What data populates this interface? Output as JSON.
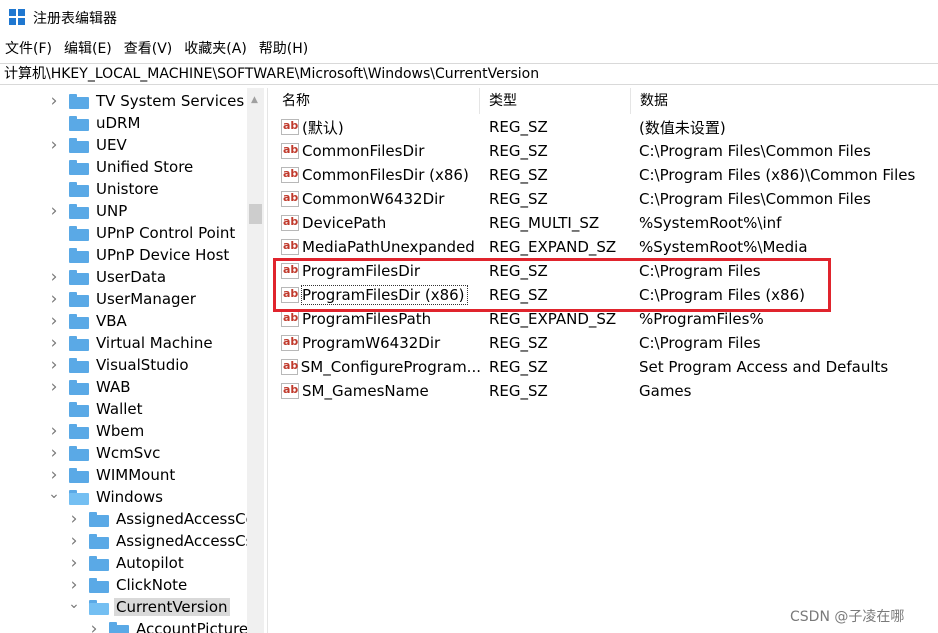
{
  "window": {
    "title": "注册表编辑器",
    "brand_color": "#1f77d0",
    "highlight_color": "#e0242d"
  },
  "menu": [
    "文件(F)",
    "编辑(E)",
    "查看(V)",
    "收藏夹(A)",
    "帮助(H)"
  ],
  "address": "计算机\\HKEY_LOCAL_MACHINE\\SOFTWARE\\Microsoft\\Windows\\CurrentVersion",
  "tree": {
    "items": [
      {
        "label": "TV System Services",
        "has_children": true,
        "expanded": false,
        "level": 0
      },
      {
        "label": "uDRM",
        "has_children": false,
        "expanded": false,
        "level": 0
      },
      {
        "label": "UEV",
        "has_children": true,
        "expanded": false,
        "level": 0
      },
      {
        "label": "Unified Store",
        "has_children": false,
        "expanded": false,
        "level": 0
      },
      {
        "label": "Unistore",
        "has_children": false,
        "expanded": false,
        "level": 0
      },
      {
        "label": "UNP",
        "has_children": true,
        "expanded": false,
        "level": 0
      },
      {
        "label": "UPnP Control Point",
        "has_children": false,
        "expanded": false,
        "level": 0
      },
      {
        "label": "UPnP Device Host",
        "has_children": false,
        "expanded": false,
        "level": 0
      },
      {
        "label": "UserData",
        "has_children": true,
        "expanded": false,
        "level": 0
      },
      {
        "label": "UserManager",
        "has_children": true,
        "expanded": false,
        "level": 0
      },
      {
        "label": "VBA",
        "has_children": true,
        "expanded": false,
        "level": 0
      },
      {
        "label": "Virtual Machine",
        "has_children": true,
        "expanded": false,
        "level": 0
      },
      {
        "label": "VisualStudio",
        "has_children": true,
        "expanded": false,
        "level": 0
      },
      {
        "label": "WAB",
        "has_children": true,
        "expanded": false,
        "level": 0
      },
      {
        "label": "Wallet",
        "has_children": false,
        "expanded": false,
        "level": 0
      },
      {
        "label": "Wbem",
        "has_children": true,
        "expanded": false,
        "level": 0
      },
      {
        "label": "WcmSvc",
        "has_children": true,
        "expanded": false,
        "level": 0
      },
      {
        "label": "WIMMount",
        "has_children": true,
        "expanded": false,
        "level": 0
      },
      {
        "label": "Windows",
        "has_children": true,
        "expanded": true,
        "level": 0
      },
      {
        "label": "AssignedAccessCo",
        "has_children": true,
        "expanded": false,
        "level": 1
      },
      {
        "label": "AssignedAccessCs",
        "has_children": true,
        "expanded": false,
        "level": 1
      },
      {
        "label": "Autopilot",
        "has_children": true,
        "expanded": false,
        "level": 1
      },
      {
        "label": "ClickNote",
        "has_children": true,
        "expanded": false,
        "level": 1
      },
      {
        "label": "CurrentVersion",
        "has_children": true,
        "expanded": true,
        "level": 1,
        "selected": true
      },
      {
        "label": "AccountPicture",
        "has_children": true,
        "expanded": false,
        "level": 2
      }
    ]
  },
  "list": {
    "columns": [
      "名称",
      "类型",
      "数据"
    ],
    "rows": [
      {
        "name": "(默认)",
        "type": "REG_SZ",
        "data": "(数值未设置)"
      },
      {
        "name": "CommonFilesDir",
        "type": "REG_SZ",
        "data": "C:\\Program Files\\Common Files"
      },
      {
        "name": "CommonFilesDir (x86)",
        "type": "REG_SZ",
        "data": "C:\\Program Files (x86)\\Common Files"
      },
      {
        "name": "CommonW6432Dir",
        "type": "REG_SZ",
        "data": "C:\\Program Files\\Common Files"
      },
      {
        "name": "DevicePath",
        "type": "REG_MULTI_SZ",
        "data": "%SystemRoot%\\inf"
      },
      {
        "name": "MediaPathUnexpanded",
        "type": "REG_EXPAND_SZ",
        "data": "%SystemRoot%\\Media"
      },
      {
        "name": "ProgramFilesDir",
        "type": "REG_SZ",
        "data": "C:\\Program Files"
      },
      {
        "name": "ProgramFilesDir (x86)",
        "type": "REG_SZ",
        "data": "C:\\Program Files (x86)",
        "focused": true
      },
      {
        "name": "ProgramFilesPath",
        "type": "REG_EXPAND_SZ",
        "data": "%ProgramFiles%"
      },
      {
        "name": "ProgramW6432Dir",
        "type": "REG_SZ",
        "data": "C:\\Program Files"
      },
      {
        "name": "SM_ConfigureProgram...",
        "type": "REG_SZ",
        "data": "Set Program Access and Defaults"
      },
      {
        "name": "SM_GamesName",
        "type": "REG_SZ",
        "data": "Games"
      }
    ],
    "value_icon_text": "ab"
  },
  "watermark": "CSDN @子凌在哪"
}
